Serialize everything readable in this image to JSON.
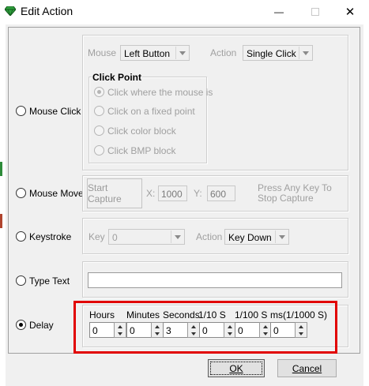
{
  "window": {
    "title": "Edit Action",
    "close_glyph": "✕",
    "minimize_glyph": "—"
  },
  "mouse_click": {
    "label": "Mouse Click",
    "mouse_label": "Mouse",
    "mouse_value": "Left Button",
    "action_label": "Action",
    "action_value": "Single Click",
    "click_point_title": "Click Point",
    "options": [
      "Click where the mouse is",
      "Click on a fixed point",
      "Click color block",
      "Click BMP block"
    ]
  },
  "mouse_move": {
    "label": "Mouse Move",
    "start_capture": "Start Capture",
    "x_label": "X:",
    "x_value": "1000",
    "y_label": "Y:",
    "y_value": "600",
    "hint_line1": "Press Any Key To",
    "hint_line2": "Stop Capture"
  },
  "keystroke": {
    "label": "Keystroke",
    "key_label": "Key",
    "key_value": "0",
    "action_label": "Action",
    "action_value": "Key Down"
  },
  "type_text": {
    "label": "Type Text",
    "value": ""
  },
  "delay": {
    "label": "Delay",
    "headers": [
      "Hours",
      "Minutes",
      "Seconds",
      "1/10 S",
      "1/100 S",
      "ms(1/1000 S)"
    ],
    "values": [
      "0",
      "0",
      "3",
      "0",
      "0",
      "0"
    ],
    "selected": true
  },
  "buttons": {
    "ok": "OK",
    "cancel": "Cancel"
  },
  "colors": {
    "highlight": "#e10000",
    "dialog_bg": "#f0f0f0",
    "icon": "#2e9e3c"
  }
}
